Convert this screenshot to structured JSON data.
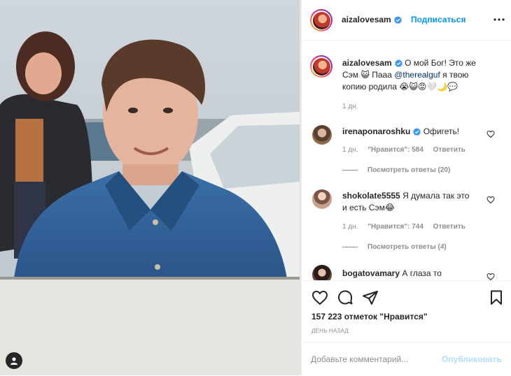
{
  "post": {
    "author": {
      "username": "aizalovesam",
      "follow_label": "Подписаться"
    },
    "caption": {
      "username": "aizalovesam",
      "text_part1": "О мой Бог! Это же",
      "text_part2": "Сэм 😺 Пааа",
      "mention": "@therealguf",
      "text_part3": "я твою",
      "text_part4": "копию родила 😭😺😡🤍🌙💬",
      "time": "1 дн."
    },
    "comments": [
      {
        "username": "irenaponaroshku",
        "text": "Офигеть!",
        "time": "1 дн.",
        "likes_label": "\"Нравится\": 584",
        "reply_label": "Ответить",
        "view_replies": "Посмотреть ответы (20)"
      },
      {
        "username": "shokolate5555",
        "text": "Я думала так это",
        "text_line2": "и есть Сэм😂",
        "time": "1 дн.",
        "likes_label": "\"Нравится\": 744",
        "reply_label": "Ответить",
        "view_replies": "Посмотреть ответы (4)"
      },
      {
        "username": "bogatovamary",
        "text": "А глаза то"
      }
    ],
    "likes_count": "157 223 отметок \"Нравится\"",
    "posted_ago": "ДЕНЬ НАЗАД",
    "add_comment_placeholder": "Добавьте комментарий...",
    "publish_label": "Опубликовать"
  },
  "colors": {
    "link": "#0095f6",
    "muted": "#8e8e8e",
    "publish_disabled": "#b2dffc"
  },
  "icons": [
    "verified-badge-icon",
    "more-options-icon",
    "heart-icon",
    "comment-icon",
    "share-icon",
    "bookmark-icon",
    "user-tag-icon"
  ]
}
